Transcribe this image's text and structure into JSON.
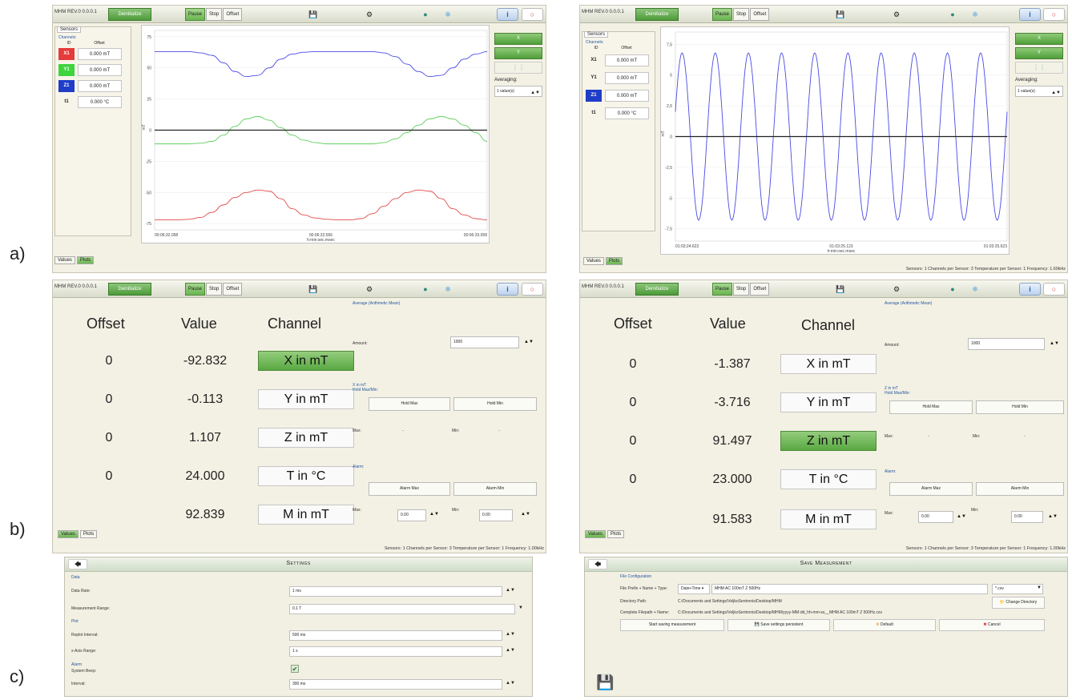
{
  "labels": {
    "a": "a)",
    "b": "b)",
    "c": "c)"
  },
  "toolbar": {
    "title": "MHM REV.0 0.0.0.1",
    "deinit": "Deinitialize",
    "pause": "Pause",
    "stop": "Stop",
    "offset": "Offset"
  },
  "sensors": {
    "title": "Sensors",
    "channels": "Channels:",
    "col_id": "ID",
    "col_offset": "Offset",
    "rows": [
      {
        "id": "X1",
        "offset": "0.000 mT"
      },
      {
        "id": "Y1",
        "offset": "0.000 mT"
      },
      {
        "id": "Z1",
        "offset": "0.000 mT"
      },
      {
        "id": "t1",
        "offset": "0.000 °C"
      }
    ]
  },
  "right": {
    "btn_x": "X",
    "btn_y": "Y",
    "averaging": "Averaging:",
    "avg_value": "1 value(s)"
  },
  "tabs": {
    "values": "Values",
    "plots": "Plots"
  },
  "status": "Sensors: 1   Channels per Sensor: 3 Temperature per Sensor: 1   Frequency: 1.00kHz",
  "status2": "Sensors: 1   Channels per Sensor: 3 Temperature per Sensor: 1   Frequency: 1.60kHz",
  "chart_data": [
    {
      "type": "line",
      "ylabel": "mT",
      "ylim": [
        -80,
        80
      ],
      "yticks": [
        75,
        50,
        25,
        0,
        -25,
        -50,
        -75
      ],
      "xticklabels": [
        "00:06:32.058",
        "00:06:32.556",
        "00:06:33.058"
      ],
      "xlabel": "h:min:sec.msec",
      "series": [
        {
          "color": "#4a4ae6",
          "values": [
            63,
            63,
            63,
            63,
            62,
            60,
            54,
            47,
            43,
            44,
            50,
            57,
            61,
            62.5,
            63,
            63,
            63,
            63,
            63,
            63,
            62,
            59,
            53,
            47,
            43,
            44,
            50,
            57,
            61,
            63
          ]
        },
        {
          "color": "#5ccf5c",
          "values": [
            -11,
            -11,
            -11,
            -11,
            -10.5,
            -9,
            -4,
            3,
            9,
            11,
            8,
            2,
            -4,
            -8,
            -10,
            -11,
            -11,
            -11,
            -11,
            -11,
            -10,
            -7,
            -2,
            4,
            9,
            11,
            9,
            4,
            -2,
            -9
          ]
        },
        {
          "color": "#e34a4a",
          "values": [
            -72,
            -72,
            -72,
            -71.5,
            -70,
            -66,
            -60,
            -54,
            -50,
            -48,
            -49,
            -55,
            -63,
            -68,
            -70.5,
            -71.5,
            -72,
            -72,
            -71,
            -67,
            -61,
            -55,
            -50,
            -48,
            -49,
            -55,
            -63,
            -68,
            -71,
            -72
          ]
        },
        {
          "color": "#222222",
          "values": [
            0,
            0,
            0,
            0,
            0,
            0,
            0,
            0,
            0,
            0,
            0,
            0,
            0,
            0,
            0,
            0,
            0,
            0,
            0,
            0,
            0,
            0,
            0,
            0,
            0,
            0,
            0,
            0,
            0,
            0
          ]
        }
      ]
    },
    {
      "type": "line",
      "ylabel": "mT",
      "ylim": [
        -8.5,
        8.5
      ],
      "yticks": [
        7.5,
        5,
        2.5,
        0,
        -2.5,
        -5,
        -7.5
      ],
      "yticklabels": [
        "7,5",
        "5",
        "2,5",
        "0",
        "-2,5",
        "-5",
        "-7,5"
      ],
      "xticklabels": [
        "01:03:24.623",
        "01:03:25.123",
        "01:03:25.623"
      ],
      "xlabel": "h:min:sec.msec",
      "series": [
        {
          "color": "#4a4ae6",
          "amplitude": 6.8,
          "cycles": 10
        },
        {
          "color": "#222222",
          "values": [
            0,
            0
          ]
        }
      ]
    }
  ],
  "values_left": {
    "headers": {
      "offset": "Offset",
      "value": "Value",
      "channel": "Channel"
    },
    "rows": [
      {
        "offset": "0",
        "value": "-92.832",
        "channel": "X in mT"
      },
      {
        "offset": "0",
        "value": "-0.113",
        "channel": "Y in mT"
      },
      {
        "offset": "0",
        "value": "1.107",
        "channel": "Z in mT"
      },
      {
        "offset": "0",
        "value": "24.000",
        "channel": "T in °C"
      },
      {
        "offset": "",
        "value": "92.839",
        "channel": "M in mT"
      }
    ],
    "side_axis": "X in mT"
  },
  "values_right": {
    "rows": [
      {
        "offset": "0",
        "value": "-1.387",
        "channel": "X in mT"
      },
      {
        "offset": "0",
        "value": "-3.716",
        "channel": "Y in mT"
      },
      {
        "offset": "0",
        "value": "91.497",
        "channel": "Z in mT"
      },
      {
        "offset": "0",
        "value": "23.000",
        "channel": "T in °C"
      },
      {
        "offset": "",
        "value": "91.583",
        "channel": "M in mT"
      }
    ],
    "side_axis": "Z in mT"
  },
  "side": {
    "avg_title": "Average (Arithmetic Mean)",
    "amount": "Amount:",
    "amount_val": "1000",
    "holdmaxmin": "Hold Max/Min:",
    "hold_max": "Hold Max",
    "hold_min": "Hold Min",
    "max": "Max:",
    "min": "Min:",
    "dash": "-",
    "alarm": "Alarm:",
    "alarm_max": "Alarm Max",
    "alarm_min": "Alarm Min",
    "zero": "0.00"
  },
  "settings": {
    "title": "Settings",
    "sec_data": "Data",
    "data_rate": "Data Rate:",
    "data_rate_val": "1 ms",
    "range": "Measurement Range:",
    "range_val": "0.1 T",
    "sec_plot": "Plot",
    "replot": "Replot Interval:",
    "replot_val": "500 ms",
    "xrange": "x-Axis Range:",
    "xrange_val": "1 s",
    "sec_alarm": "Alarm",
    "beep": "System Beep:",
    "interval": "Interval:",
    "interval_val": "300 ms"
  },
  "save": {
    "title": "Save Measurement",
    "sec": "File Configuration",
    "prefix_label": "File Prefix + Name + Type:",
    "prefix_type": "Date+Time",
    "name_val": "MHM AC 100mT Z 500Hz",
    "ext": "*.csv",
    "dir_label": "Directory Path:",
    "dir_val": "C:/Documents and Settings/VeljkoSentronis/Desktop/MHM",
    "change_dir": "Change Directory",
    "full_label": "Complete Filepath + Name:",
    "full_val": "C:/Documents and Settings/VeljkoSentronis/Desktop/MHM/yyyy-MM-dd_hh-mm-ss__MHM AC 100mT Z 500Hz.csv",
    "start": "Start saving measurement",
    "persist": "Save settings persistent",
    "default": "Default",
    "cancel": "Cancel"
  },
  "colors": {
    "x": "#e53b3b",
    "y": "#3ed43e",
    "z": "#1f3dc7",
    "green_btn": "#5aa944"
  }
}
